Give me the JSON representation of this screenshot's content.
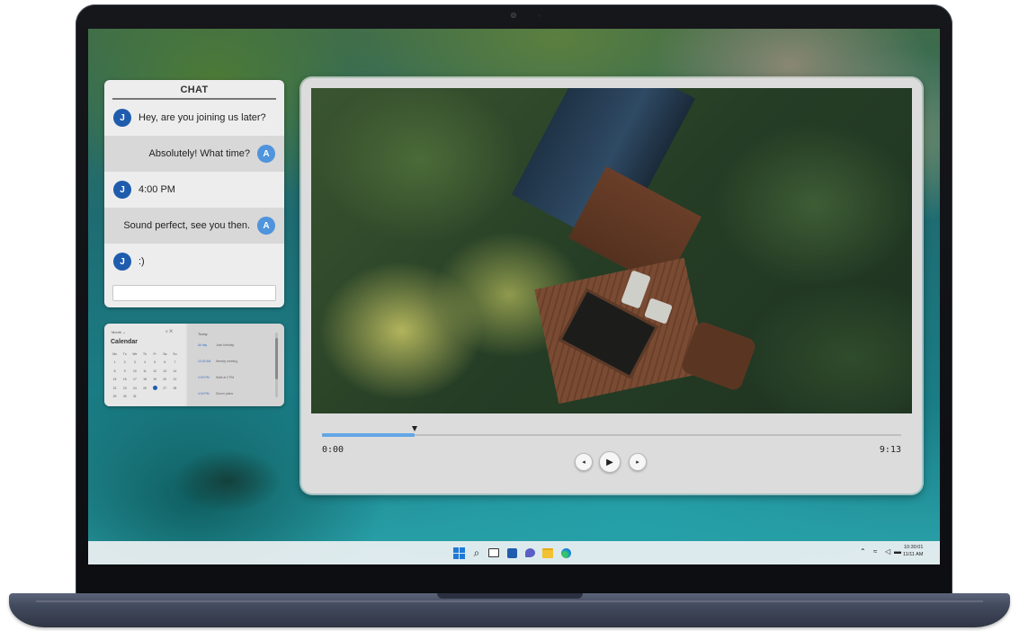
{
  "chat": {
    "title": "CHAT",
    "messages": [
      {
        "from": "J",
        "text": "Hey, are you joining us later?"
      },
      {
        "from": "A",
        "text": "Absolutely! What time?"
      },
      {
        "from": "J",
        "text": "4:00 PM"
      },
      {
        "from": "A",
        "text": "Sound perfect, see you then."
      },
      {
        "from": "J",
        "text": ":)"
      }
    ],
    "input_placeholder": ""
  },
  "calendar": {
    "view": "Month ⌄",
    "title": "Calendar",
    "weekdays": [
      "Mo",
      "Tu",
      "We",
      "Th",
      "Fr",
      "Sa",
      "Su"
    ],
    "days": [
      [
        "1",
        "2",
        "3",
        "4",
        "5",
        "6",
        "7"
      ],
      [
        "8",
        "9",
        "10",
        "11",
        "12",
        "13",
        "14"
      ],
      [
        "15",
        "16",
        "17",
        "18",
        "19",
        "20",
        "21"
      ],
      [
        "22",
        "23",
        "24",
        "25",
        "26",
        "27",
        "28"
      ],
      [
        "29",
        "30",
        "31",
        "",
        "",
        "",
        ""
      ]
    ],
    "events_header": "Today",
    "events": [
      {
        "time": "All day",
        "title": "Josh birthday"
      },
      {
        "time": "10:30 AM",
        "title": "Weekly meeting"
      },
      {
        "time": "2:00 PM",
        "title": "Walk at 2 PM"
      },
      {
        "time": "4:00 PM",
        "title": "Dinner plans"
      }
    ]
  },
  "player": {
    "current_time": "0:00",
    "duration": "9:13",
    "progress": 0.16,
    "prev_icon": "skip-back-icon",
    "play_icon": "play-icon",
    "next_icon": "skip-forward-icon"
  },
  "taskbar": {
    "pinned": [
      "start-icon",
      "search-icon",
      "task-view-icon",
      "widgets-icon",
      "chat-icon",
      "file-explorer-icon",
      "edge-icon"
    ],
    "clock_time": "10:30:01",
    "clock_date": "11/11 AM",
    "accent": "#1f7ad6"
  }
}
